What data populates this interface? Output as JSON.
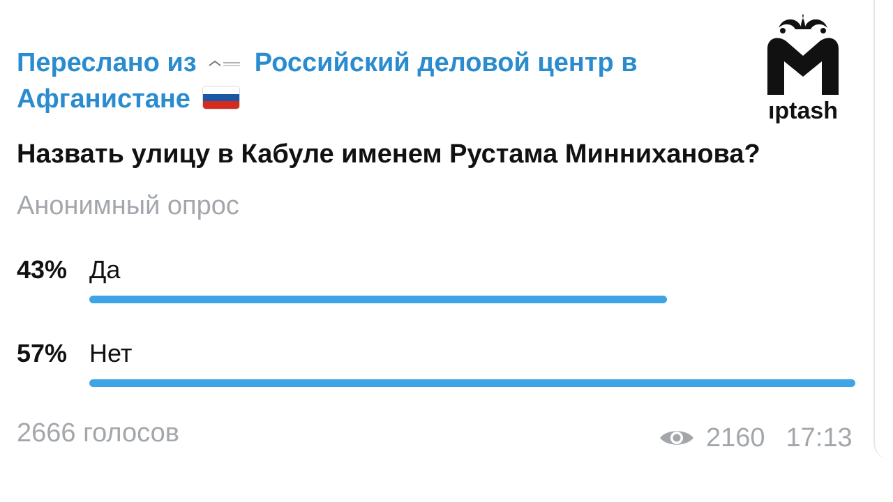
{
  "forward": {
    "prefix": "Переслано из",
    "channel": "Российский деловой центр в Афганистане",
    "flag_colors": [
      "#ffffff",
      "#1c57a5",
      "#d52b1e"
    ]
  },
  "poll": {
    "question": "Назвать улицу в Кабуле именем Рустама Минниханова?",
    "type": "Анонимный опрос",
    "options": [
      {
        "percent_label": "43%",
        "text": "Да",
        "percent": 43
      },
      {
        "percent_label": "57%",
        "text": "Нет",
        "percent": 57
      }
    ],
    "bar_color": "#3ea4e5",
    "votes": "2666 голосов"
  },
  "footer": {
    "views_icon": "eye-icon",
    "views": "2160",
    "time": "17:13"
  },
  "logo": {
    "wordmark": "ıptash"
  },
  "colors": {
    "link": "#2a8ccf",
    "muted": "#a3a7ab",
    "text": "#111111"
  }
}
